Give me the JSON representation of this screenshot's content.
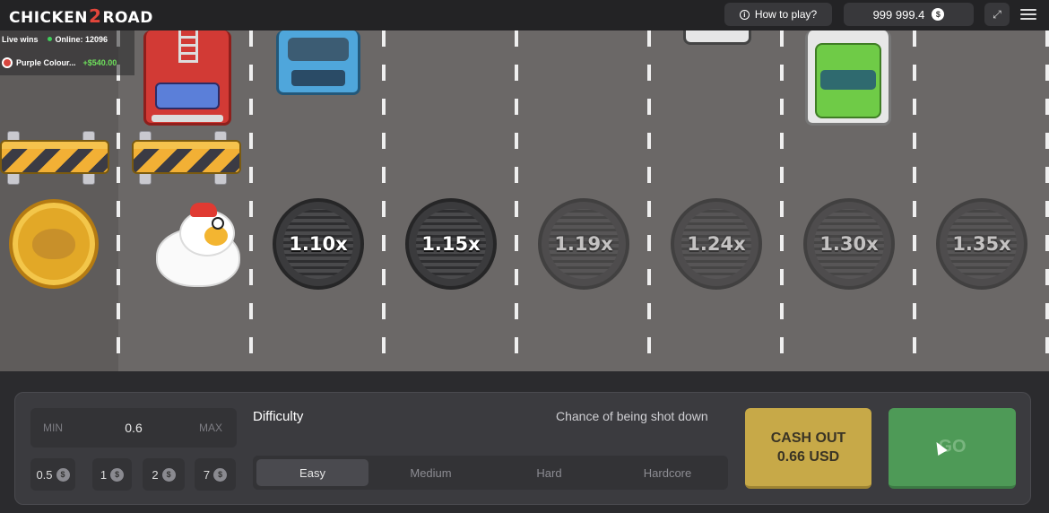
{
  "header": {
    "logo_part1": "CHICKEN",
    "logo_part2": "2",
    "logo_part3": "ROAD",
    "how_to_play": "How to play?",
    "balance": "999 999.4",
    "currency_icon": "dollar-coin-icon"
  },
  "live_wins": {
    "title": "Live wins",
    "online": "Online: 12096",
    "entry_name": "Purple Colour...",
    "entry_amount": "+$540.00"
  },
  "multipliers": [
    "1.10x",
    "1.15x",
    "1.19x",
    "1.24x",
    "1.30x",
    "1.35x"
  ],
  "bet": {
    "min_label": "MIN",
    "value": "0.6",
    "max_label": "MAX",
    "quick_bets": [
      "0.5",
      "1",
      "2",
      "7"
    ]
  },
  "difficulty": {
    "label": "Difficulty",
    "chance_label": "Chance of being shot down",
    "options": [
      "Easy",
      "Medium",
      "Hard",
      "Hardcore"
    ],
    "selected": "Easy"
  },
  "actions": {
    "cashout_line1": "CASH OUT",
    "cashout_line2": "0.66 USD",
    "go": "GO"
  },
  "colors": {
    "road": "#6b6867",
    "cashout": "#c7a948",
    "go": "#4e9a57",
    "win_amount": "#6ee05c"
  }
}
